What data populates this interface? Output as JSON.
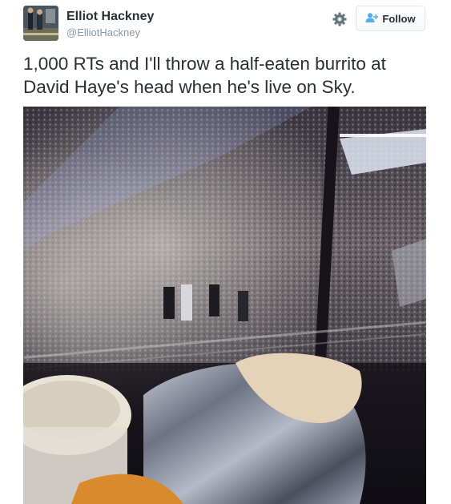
{
  "tweet": {
    "author_name": "Elliot Hackney",
    "author_handle": "@ElliotHackney",
    "follow_label": "Follow",
    "text": "1,000 RTs and I'll throw a half-eaten burrito at David Haye's head when he's live on Sky."
  },
  "icons": {
    "settings": "gear-icon",
    "follow": "add-user-icon"
  },
  "colors": {
    "text": "#292f33",
    "secondary_text": "#8899a6",
    "follow_icon": "#55acee",
    "button_border": "#e1e8ed"
  }
}
